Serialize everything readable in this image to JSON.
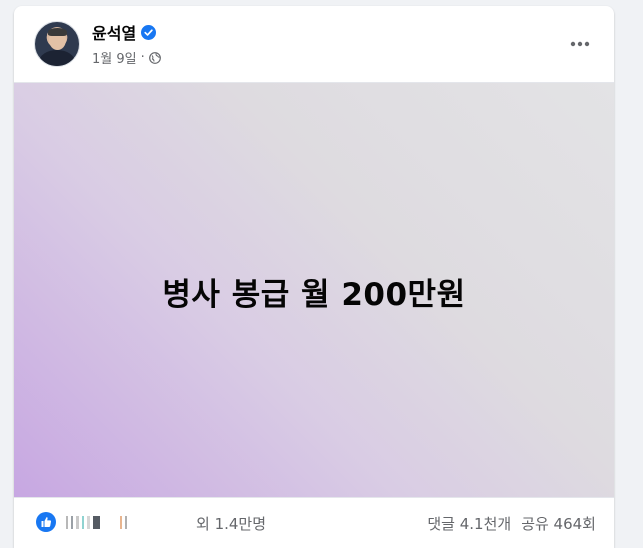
{
  "post": {
    "author": "윤석열",
    "verified": true,
    "date": "1월 9일",
    "date_separator": "·",
    "privacy_icon": "globe-icon",
    "more_icon": "more-horizontal-icon",
    "image_text": "병사 봉급 월 200만원"
  },
  "footer": {
    "reaction_icon": "like-icon",
    "reactions_label": "외 1.4만명",
    "comments_label": "댓글 4.1천개",
    "shares_label": "공유 464회"
  },
  "colors": {
    "facebook_blue": "#1877f2",
    "text_primary": "#050505",
    "text_secondary": "#65676b",
    "gradient_start": "#c7a7e2",
    "gradient_end": "#e3e3e5"
  }
}
